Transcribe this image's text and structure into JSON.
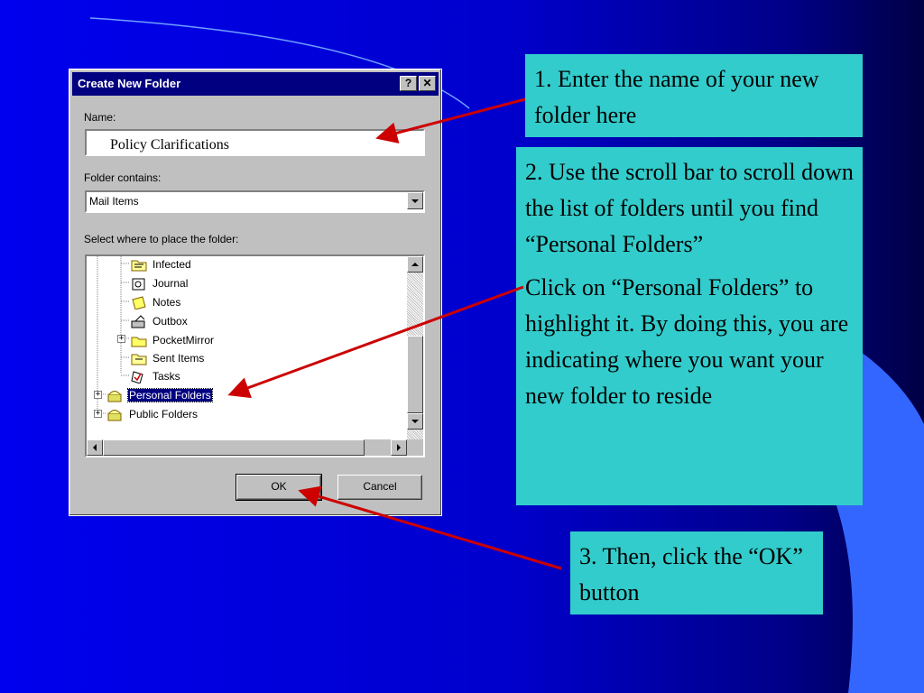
{
  "dialog": {
    "title": "Create New Folder",
    "help_glyph": "?",
    "close_glyph": "✕",
    "name_label": "Name:",
    "name_value": "Policy Clarifications",
    "contains_label": "Folder contains:",
    "contains_value": "Mail Items",
    "place_label": "Select where to place the folder:",
    "tree_items": [
      {
        "label": "Infected",
        "icon": "folder-icon"
      },
      {
        "label": "Journal",
        "icon": "journal-icon"
      },
      {
        "label": "Notes",
        "icon": "notes-icon"
      },
      {
        "label": "Outbox",
        "icon": "outbox-icon"
      },
      {
        "label": "PocketMirror",
        "icon": "folder-icon",
        "expandable": true
      },
      {
        "label": "Sent Items",
        "icon": "sent-items-icon"
      },
      {
        "label": "Tasks",
        "icon": "tasks-icon"
      },
      {
        "label": "Personal Folders",
        "icon": "personal-folders-icon",
        "expandable": true,
        "selected": true
      },
      {
        "label": "Public Folders",
        "icon": "public-folders-icon",
        "expandable": true
      }
    ],
    "ok_label": "OK",
    "cancel_label": "Cancel"
  },
  "callouts": {
    "step1": "1. Enter the name of your new folder here",
    "step2_a": "2. Use the scroll bar to scroll down the list of folders until you find “Personal Folders”",
    "step2_b": "Click on “Personal Folders” to highlight it. By doing this, you are indicating where you want your new folder to reside",
    "step3": "3. Then, click the “OK” button"
  },
  "colors": {
    "background": "#0000ee",
    "callout": "#33cccc",
    "arrow": "#cc0000",
    "titlebar": "#000080"
  }
}
